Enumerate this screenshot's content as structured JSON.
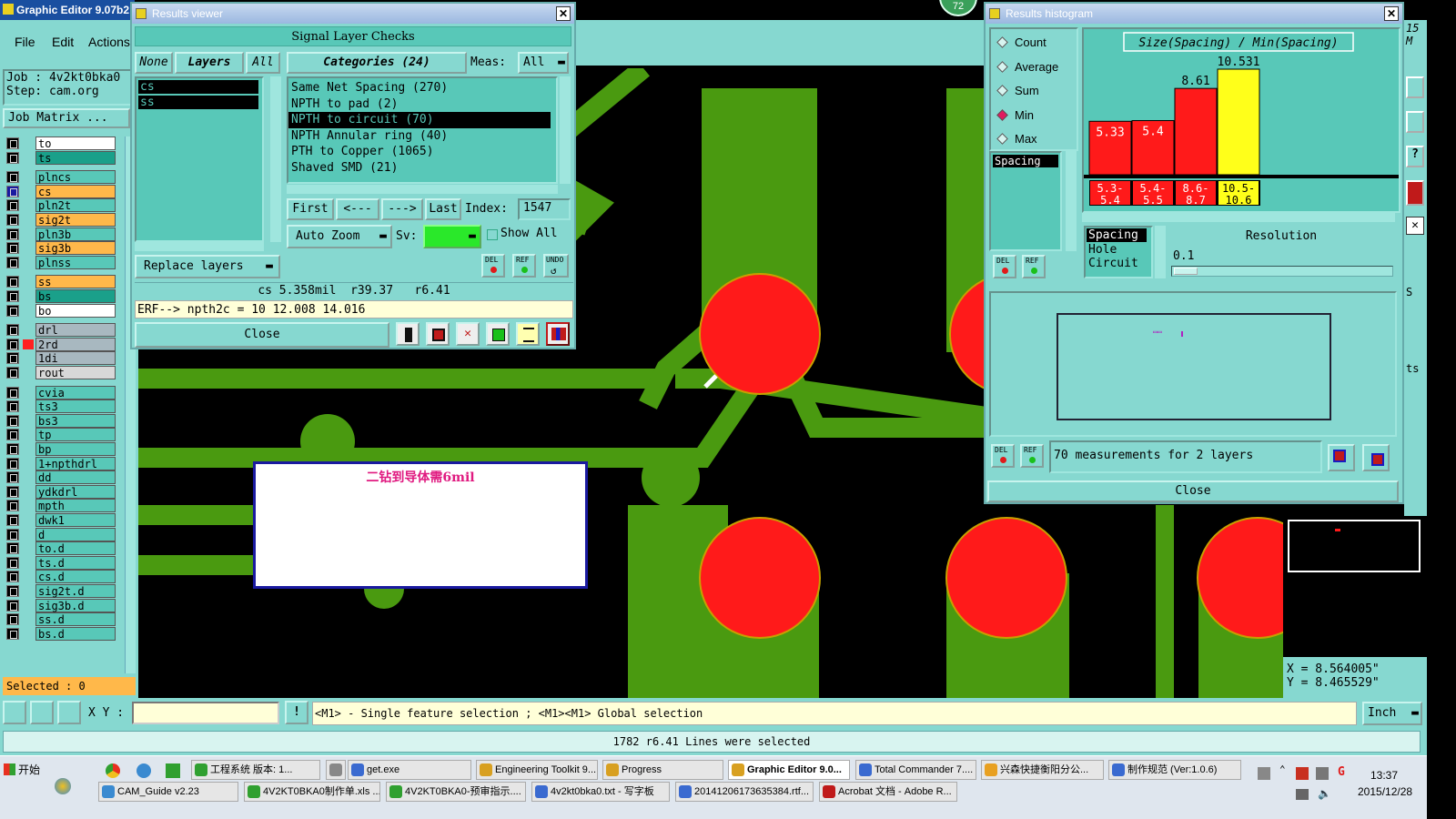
{
  "app": {
    "title": "Graphic Editor 9.07b2",
    "menu": [
      "File",
      "Edit",
      "Actions"
    ],
    "job_label": "Job : 4v2kt0bka0",
    "step_label": "Step: cam.org",
    "job_matrix": "Job Matrix ...",
    "selected": "Selected : 0",
    "badge": "72",
    "right_edge_text": [
      "15",
      "M",
      "S",
      "ts"
    ]
  },
  "layers": [
    {
      "name": "to",
      "color": "#ffffff"
    },
    {
      "name": "ts",
      "color": "#1aa08a"
    },
    {
      "name": "plncs",
      "color": "#58c8b8"
    },
    {
      "name": "cs",
      "color": "#ffb84a",
      "active": true
    },
    {
      "name": "pln2t",
      "color": "#58c8b8"
    },
    {
      "name": "sig2t",
      "color": "#ffb84a"
    },
    {
      "name": "pln3b",
      "color": "#58c8b8"
    },
    {
      "name": "sig3b",
      "color": "#ffb84a"
    },
    {
      "name": "plnss",
      "color": "#58c8b8"
    },
    {
      "name": "ss",
      "color": "#ffb84a"
    },
    {
      "name": "bs",
      "color": "#1aa08a"
    },
    {
      "name": "bo",
      "color": "#ffffff"
    },
    {
      "name": "drl",
      "color": "#a8b8c0"
    },
    {
      "name": "2rd",
      "color": "#a8b8c0",
      "marker": "#ff2020"
    },
    {
      "name": "1di",
      "color": "#a8b8c0"
    },
    {
      "name": "rout",
      "color": "#d8d8d8"
    },
    {
      "name": "cvia",
      "color": "#58c8b8"
    },
    {
      "name": "ts3",
      "color": "#58c8b8"
    },
    {
      "name": "bs3",
      "color": "#58c8b8"
    },
    {
      "name": "tp",
      "color": "#58c8b8"
    },
    {
      "name": "bp",
      "color": "#58c8b8"
    },
    {
      "name": "1+npthdrl",
      "color": "#58c8b8"
    },
    {
      "name": "dd",
      "color": "#58c8b8"
    },
    {
      "name": "ydkdrl",
      "color": "#58c8b8"
    },
    {
      "name": "mpth",
      "color": "#58c8b8"
    },
    {
      "name": "dwk1",
      "color": "#58c8b8"
    },
    {
      "name": "d",
      "color": "#58c8b8"
    },
    {
      "name": "to.d",
      "color": "#58c8b8"
    },
    {
      "name": "ts.d",
      "color": "#58c8b8"
    },
    {
      "name": "cs.d",
      "color": "#58c8b8"
    },
    {
      "name": "sig2t.d",
      "color": "#58c8b8"
    },
    {
      "name": "sig3b.d",
      "color": "#58c8b8"
    },
    {
      "name": "ss.d",
      "color": "#58c8b8"
    },
    {
      "name": "bs.d",
      "color": "#58c8b8"
    }
  ],
  "results_viewer": {
    "title": "Results viewer",
    "header": "Signal Layer Checks",
    "tab_none": "None",
    "tab_layers": "Layers",
    "tab_all": "All",
    "layer_list": [
      "cs",
      "ss"
    ],
    "categories_label": "Categories (24)",
    "meas_label": "Meas:",
    "meas_value": "All",
    "categories": [
      "Same Net Spacing (270)",
      "NPTH to pad (2)",
      "NPTH to circuit (70)",
      "NPTH Annular ring (40)",
      "PTH to Copper (1065)",
      "Shaved SMD (21)"
    ],
    "selected_category": 2,
    "first": "First",
    "prev": "<---",
    "next": "--->",
    "last": "Last",
    "index_label": "Index:",
    "index_value": "1547",
    "auto_zoom": "Auto Zoom",
    "sv_label": "Sv:",
    "show_all": "Show All",
    "replace_layers": "Replace layers",
    "del": "DEL",
    "ref": "REF",
    "undo": "UNDO",
    "info_line": "cs 5.358mil  r39.37   r6.41",
    "erf_line": "ERF--> npth2c = 10 12.008 14.016",
    "close": "Close"
  },
  "annotation_text": "二钻到导体需6mil",
  "histogram": {
    "title": "Results histogram",
    "modes": [
      "Count",
      "Average",
      "Sum",
      "Min",
      "Max"
    ],
    "selected_mode": "Min",
    "chart_title": "Size(Spacing) / Min(Spacing)",
    "list_item": "Spacing",
    "del": "DEL",
    "ref": "REF",
    "bottom_list": [
      "Spacing",
      "Hole",
      "Circuit"
    ],
    "resolution_label": "Resolution",
    "resolution_value": "0.1",
    "measurements": "70 measurements for 2 layers",
    "close": "Close",
    "preview_marker": "▭▭"
  },
  "chart_data": {
    "type": "bar",
    "categories": [
      "5.3-5.4",
      "5.4-5.5",
      "8.6-8.7",
      "10.5-10.6"
    ],
    "values": [
      5.33,
      5.4,
      8.61,
      10.531
    ],
    "value_labels": [
      "5.33",
      "5.4",
      "8.61",
      "10.531"
    ],
    "category_labels": [
      [
        "5.3-",
        "5.4"
      ],
      [
        "5.4-",
        "5.5"
      ],
      [
        "8.6-",
        "8.7"
      ],
      [
        "10.5-",
        "10.6"
      ]
    ],
    "colors": [
      "#ff1a1a",
      "#ff1a1a",
      "#ff1a1a",
      "#ffff1a"
    ],
    "title": "Size(Spacing) / Min(Spacing)",
    "ylim": [
      0,
      10.531
    ]
  },
  "coords": {
    "x": "X = 8.564005\"",
    "y": "Y = 8.465529\""
  },
  "status": {
    "xy_label": "X Y :",
    "xy_value": "",
    "hint": "<M1> - Single feature selection ; <M1><M1> Global selection",
    "unit": "Inch",
    "message": "1782 r6.41 Lines were selected"
  },
  "taskbar": {
    "start": "开始",
    "row1": [
      "工程系统  版本: 1...",
      "",
      "get.exe",
      "Engineering Toolkit 9....",
      "Progress",
      "Graphic Editor 9.0...",
      "Total Commander 7....",
      "兴森快捷衡阳分公...",
      "制作规范 (Ver:1.0.6)"
    ],
    "row2": [
      "CAM_Guide v2.23",
      "4V2KT0BKA0制作单.xls ...",
      "4V2KT0BKA0-预审指示....",
      "4v2kt0bka0.txt - 写字板",
      "20141206173635384.rtf...",
      "Acrobat 文档 - Adobe R..."
    ],
    "time": "13:37",
    "date": "2015/12/28"
  }
}
